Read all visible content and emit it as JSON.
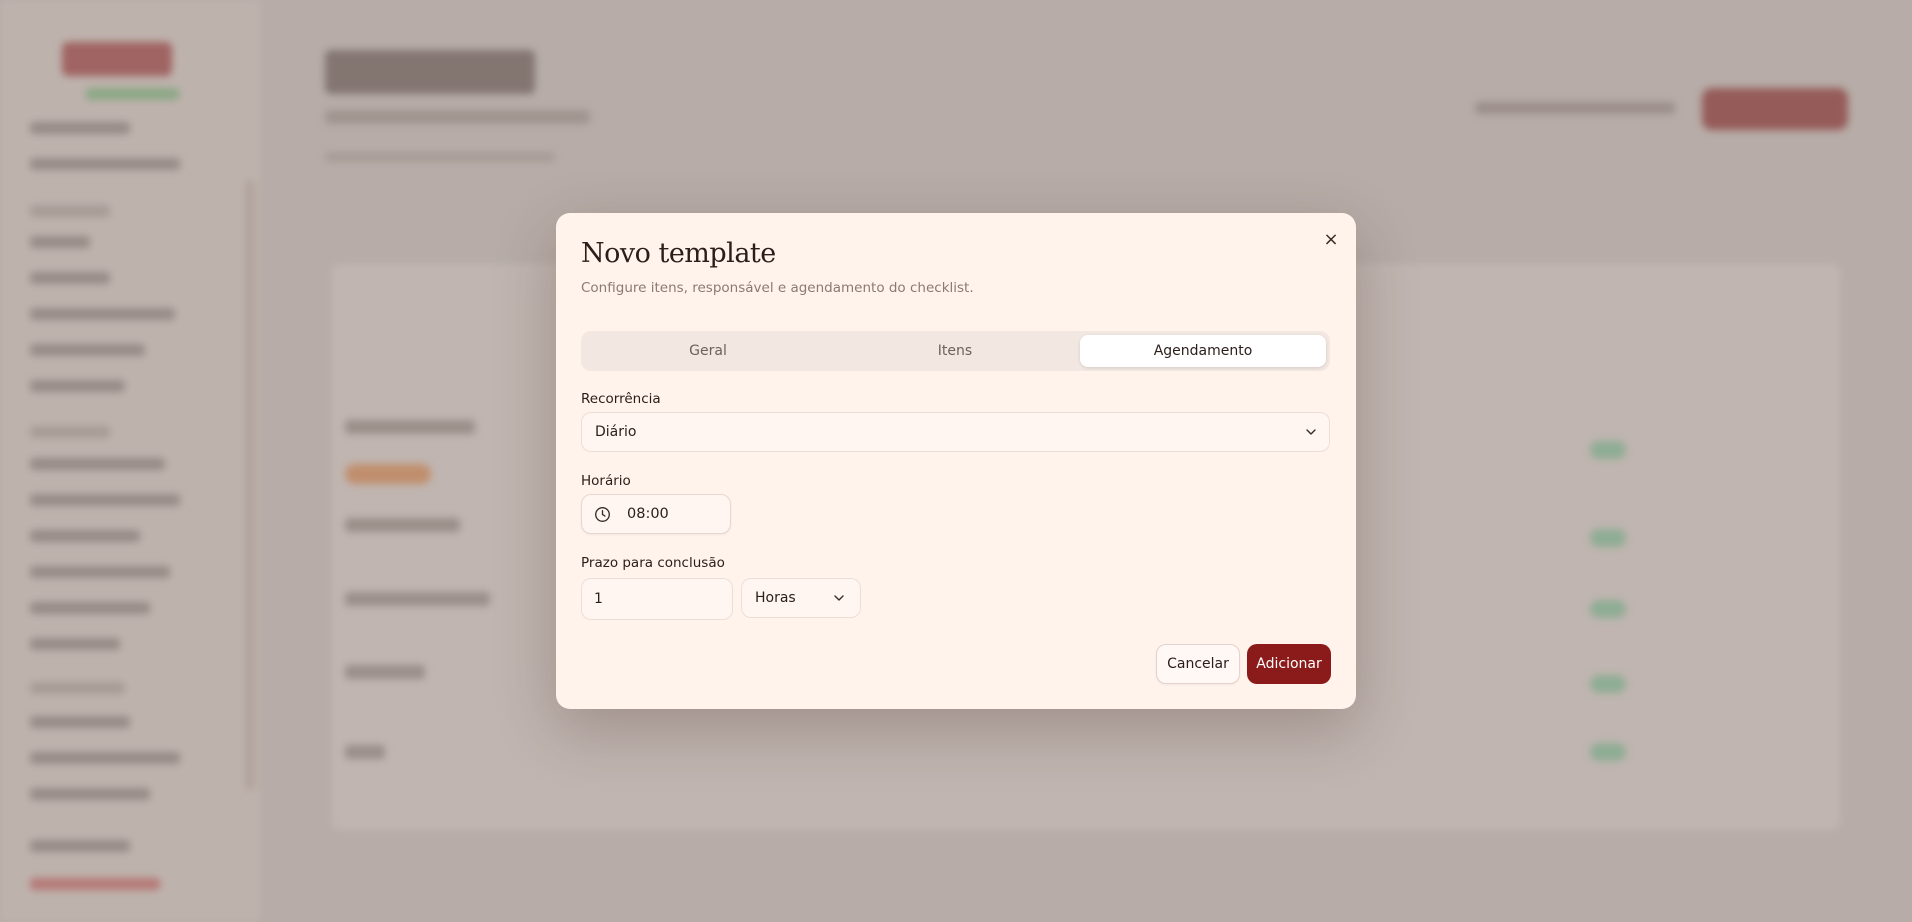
{
  "modal": {
    "title": "Novo template",
    "description": "Configure itens, responsável e agendamento do checklist.",
    "close_icon": "×",
    "tabs": [
      {
        "label": "Geral",
        "active": false
      },
      {
        "label": "Itens",
        "active": false
      },
      {
        "label": "Agendamento",
        "active": true
      }
    ],
    "recurrence": {
      "label": "Recorrência",
      "value": "Diário"
    },
    "schedule_time": {
      "label": "Horário",
      "value": "08:00"
    },
    "deadline": {
      "label": "Prazo para conclusão",
      "amount": "1",
      "unit": "Horas"
    },
    "cancel_label": "Cancelar",
    "add_label": "Adicionar"
  },
  "colors": {
    "primary": "#8b1a1a",
    "modal_bg": "#fff3ec",
    "overlay": "#b7aca7"
  }
}
